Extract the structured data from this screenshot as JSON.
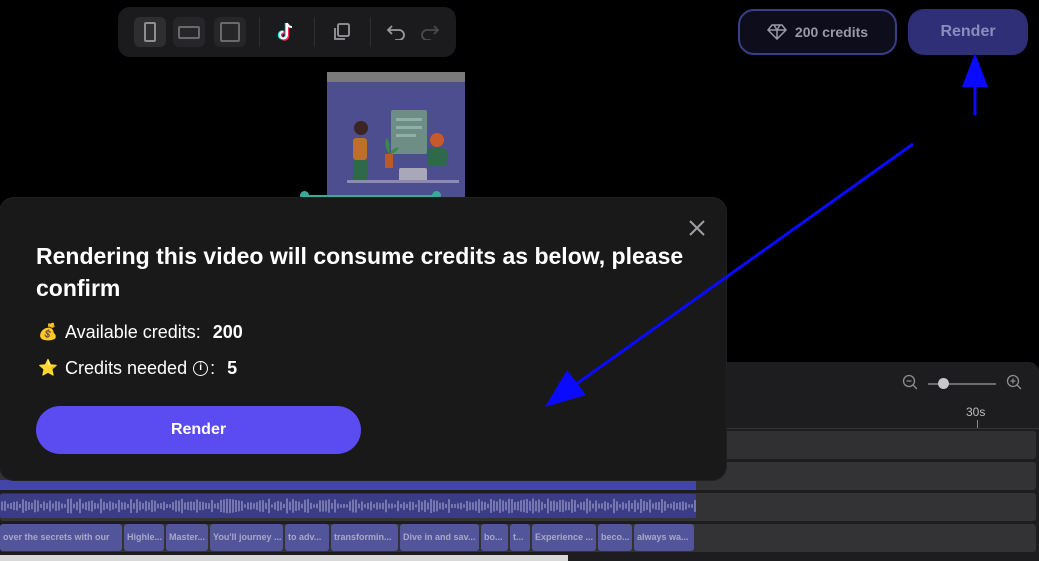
{
  "toolbar": {
    "buttons": [
      {
        "name": "portrait-aspect-icon",
        "active": true
      },
      {
        "name": "landscape-aspect-icon",
        "active": false
      },
      {
        "name": "square-aspect-icon",
        "active": false
      },
      {
        "name": "tiktok-icon",
        "active": false
      },
      {
        "name": "duplicate-icon",
        "active": false
      },
      {
        "name": "undo-icon",
        "active": false
      },
      {
        "name": "redo-icon",
        "active": false
      }
    ]
  },
  "header": {
    "credits_label": "200 credits",
    "credits_icon": "diamond-icon",
    "render_label": "Render"
  },
  "modal": {
    "title": "Rendering this video will consume credits as below, please confirm",
    "available_label": "Available credits:",
    "available_value": "200",
    "available_icon": "💰",
    "needed_label": "Credits needed",
    "needed_value": "5",
    "needed_icon": "⭐",
    "info_icon": "i",
    "render_label": "Render",
    "close_icon": "close-icon"
  },
  "timeline": {
    "ruler_label": "30s",
    "captions": [
      "over the secrets with our",
      "Highle...",
      "Master...",
      "You'll journey ...",
      "to adv...",
      "transformin...",
      "Dive in and sav...",
      "bo...",
      "t...",
      "Experience ...",
      "beco...",
      "always wa..."
    ]
  },
  "colors": {
    "accent": "#5b4cf2",
    "annotation_arrow": "#0a0aff"
  }
}
